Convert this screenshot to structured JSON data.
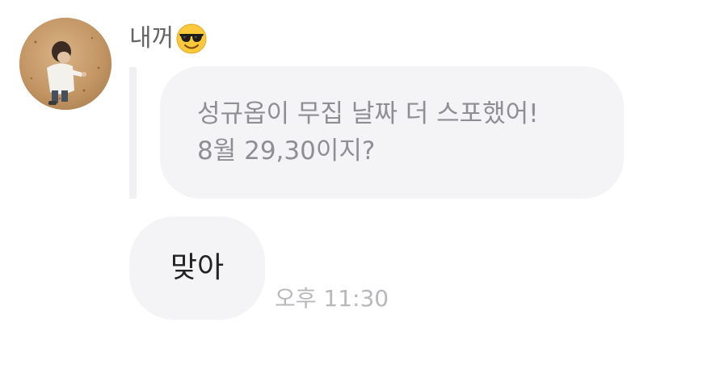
{
  "chat": {
    "sender": {
      "name": "내꺼",
      "avatar_icon": "profile-photo",
      "emoji_icon": "smiling-face-with-sunglasses"
    },
    "quoted_message": {
      "line1": "성규옵이 무집 날짜 더 스포했어!",
      "line2": "8월 29,30이지?"
    },
    "message": {
      "text": "맞아",
      "time": "오후 11:30"
    }
  }
}
